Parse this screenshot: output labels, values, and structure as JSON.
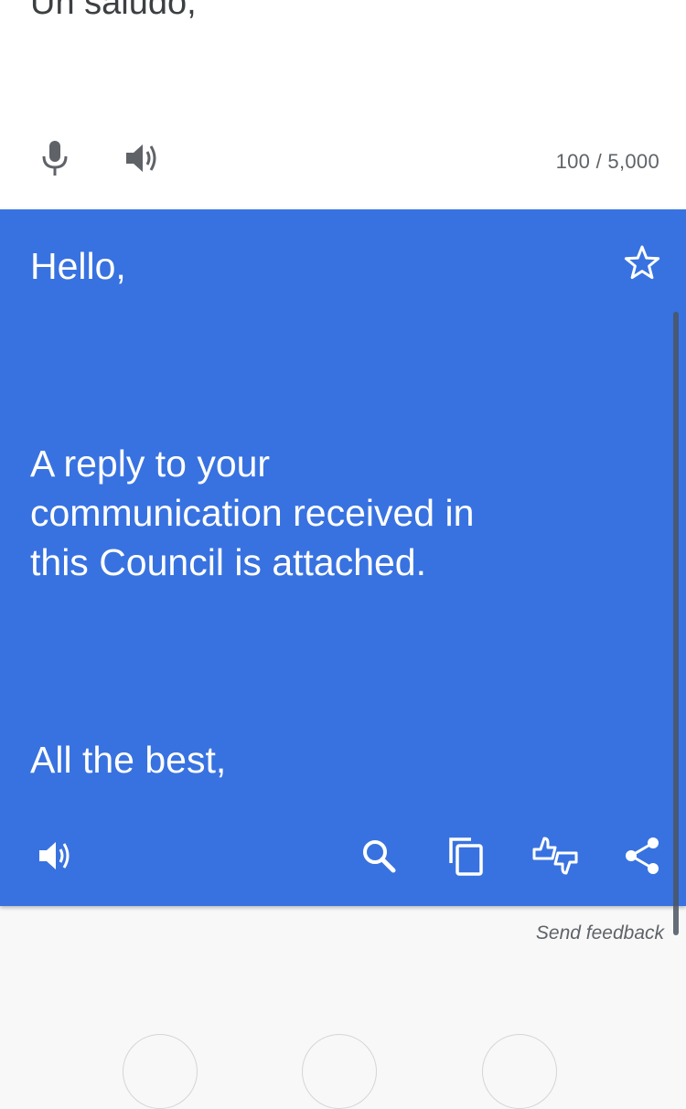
{
  "source": {
    "text": "Un saludo,",
    "char_count": "100 / 5,000",
    "icons": {
      "mic": "microphone-icon",
      "speaker": "speaker-icon"
    }
  },
  "translation": {
    "paragraphs": [
      "Hello,",
      "A reply to your\ncommunication received in\nthis Council is attached.",
      "All the best,"
    ],
    "icons": {
      "star": "star-icon",
      "speaker": "speaker-icon",
      "search": "search-icon",
      "copy": "copy-icon",
      "feedback": "thumbs-feedback-icon",
      "share": "share-icon"
    }
  },
  "footer": {
    "send_feedback": "Send feedback"
  },
  "colors": {
    "translation_bg": "#3872e0",
    "source_bg": "#ffffff",
    "page_bg": "#f8f8f8"
  }
}
